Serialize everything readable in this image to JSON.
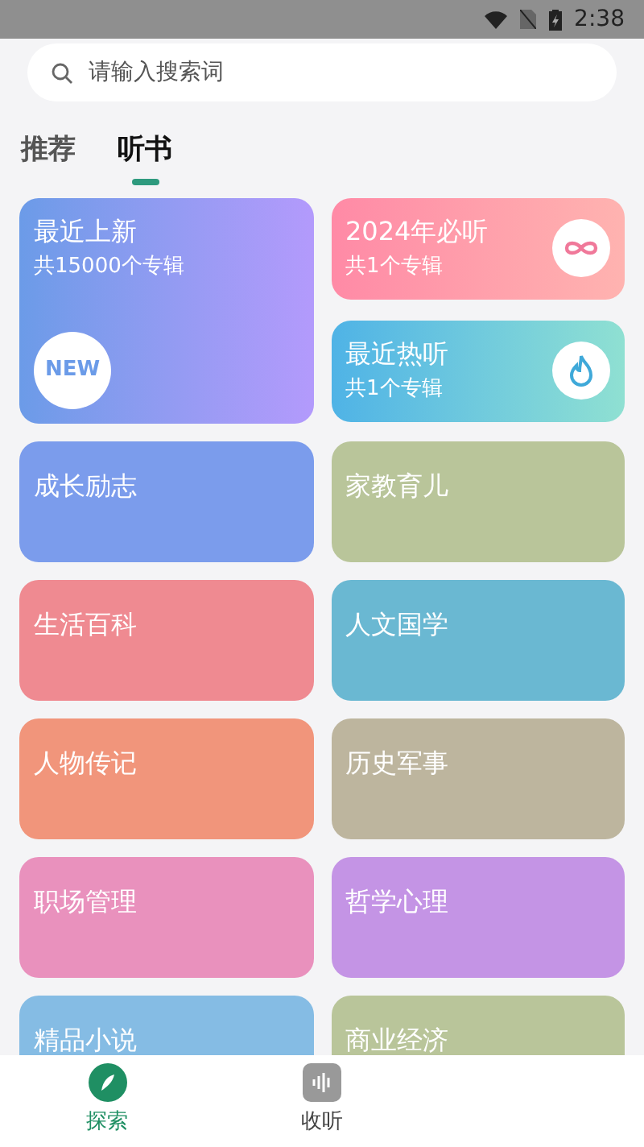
{
  "status_bar": {
    "time": "2:38"
  },
  "search": {
    "placeholder": "请输入搜索词"
  },
  "tabs": [
    {
      "label": "推荐",
      "selected": false
    },
    {
      "label": "听书",
      "selected": true
    }
  ],
  "featured": [
    {
      "kind": "new",
      "title": "最近上新",
      "subtitle": "共15000个专辑",
      "badge": "NEW"
    },
    {
      "kind": "infinity",
      "title": "2024年必听",
      "subtitle": "共1个专辑"
    },
    {
      "kind": "flame",
      "title": "最近热听",
      "subtitle": "共1个专辑"
    }
  ],
  "categories": [
    {
      "title": "成长励志",
      "color": "#7b9cec"
    },
    {
      "title": "家教育儿",
      "color": "#b9c59a"
    },
    {
      "title": "生活百科",
      "color": "#ef8a91"
    },
    {
      "title": "人文国学",
      "color": "#6ab8d2"
    },
    {
      "title": "人物传记",
      "color": "#f1957b"
    },
    {
      "title": "历史军事",
      "color": "#bdb59e"
    },
    {
      "title": "职场管理",
      "color": "#e991bd"
    },
    {
      "title": "哲学心理",
      "color": "#c494e5"
    },
    {
      "title": "精品小说",
      "color": "#85bce4"
    },
    {
      "title": "商业经济",
      "color": "#b9c59a"
    }
  ],
  "bottom_nav": [
    {
      "label": "探索",
      "kind": "explore",
      "selected": true
    },
    {
      "label": "收听",
      "kind": "listen",
      "selected": false
    }
  ]
}
